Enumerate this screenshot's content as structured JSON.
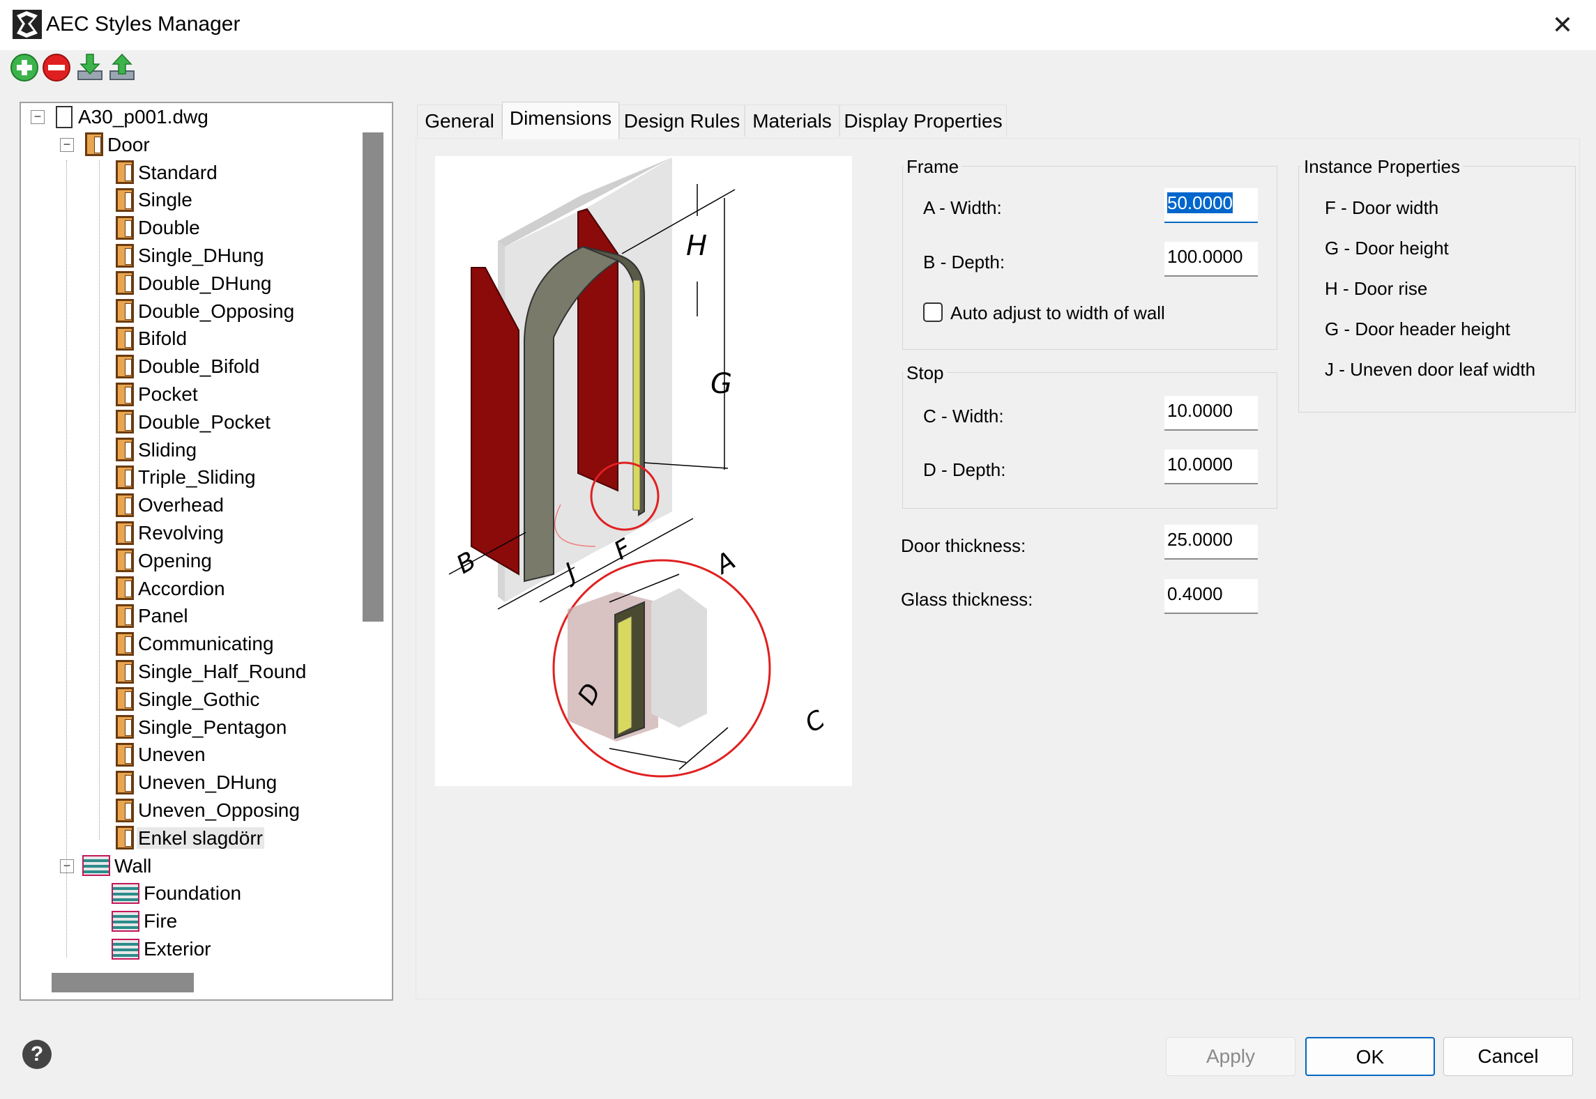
{
  "window": {
    "title": "AEC Styles Manager",
    "close_glyph": "✕"
  },
  "toolbar": {
    "buttons": [
      {
        "name": "add-icon",
        "color": "#3cb44b"
      },
      {
        "name": "remove-icon",
        "color": "#e02020"
      },
      {
        "name": "import-icon"
      },
      {
        "name": "export-icon"
      }
    ]
  },
  "tree": {
    "root": "A30_p001.dwg",
    "door": {
      "label": "Door",
      "items": [
        "Standard",
        "Single",
        "Double",
        "Single_DHung",
        "Double_DHung",
        "Double_Opposing",
        "Bifold",
        "Double_Bifold",
        "Pocket",
        "Double_Pocket",
        "Sliding",
        "Triple_Sliding",
        "Overhead",
        "Revolving",
        "Opening",
        "Accordion",
        "Panel",
        "Communicating",
        "Single_Half_Round",
        "Single_Gothic",
        "Single_Pentagon",
        "Uneven",
        "Uneven_DHung",
        "Uneven_Opposing",
        "Enkel slagdörr"
      ],
      "selected": "Enkel slagdörr"
    },
    "wall": {
      "label": "Wall",
      "items": [
        "Foundation",
        "Fire",
        "Exterior"
      ]
    }
  },
  "tabs": [
    "General",
    "Dimensions",
    "Design Rules",
    "Materials",
    "Display Properties"
  ],
  "active_tab": "Dimensions",
  "figure_labels": [
    "H",
    "G",
    "B",
    "J",
    "F",
    "A",
    "D",
    "C"
  ],
  "frame": {
    "title": "Frame",
    "a_width_label": "A - Width:",
    "a_width_value": "50.0000",
    "b_depth_label": "B - Depth:",
    "b_depth_value": "100.0000",
    "auto_adjust_label": "Auto adjust to width of wall",
    "auto_adjust_checked": false
  },
  "stop": {
    "title": "Stop",
    "c_width_label": "C - Width:",
    "c_width_value": "10.0000",
    "d_depth_label": "D - Depth:",
    "d_depth_value": "10.0000"
  },
  "door_thickness": {
    "label": "Door thickness:",
    "value": "25.0000"
  },
  "glass_thickness": {
    "label": "Glass thickness:",
    "value": "0.4000"
  },
  "instance_properties": {
    "title": "Instance Properties",
    "items": [
      "F - Door width",
      "G - Door height",
      "H - Door rise",
      "G - Door header height",
      "J - Uneven door leaf width"
    ]
  },
  "buttons": {
    "apply": "Apply",
    "ok": "OK",
    "cancel": "Cancel",
    "help": "?"
  }
}
